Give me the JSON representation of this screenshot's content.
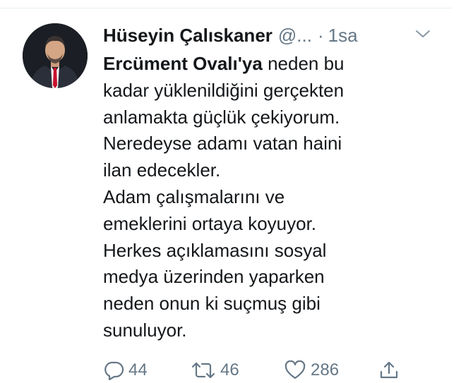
{
  "tweet": {
    "author_name": "Hüseyin Çalıskaner",
    "handle": "@...",
    "separator": "·",
    "time": "1sa",
    "text_lines": [
      {
        "bold": "Ercüment Ovalı'ya",
        "rest": " neden bu"
      },
      {
        "text": "kadar yüklenildiğini gerçekten"
      },
      {
        "text": "anlamakta güçlük çekiyorum."
      },
      {
        "text": "Neredeyse adamı vatan haini"
      },
      {
        "text": "ilan edecekler."
      },
      {
        "text": "Adam çalışmalarını ve"
      },
      {
        "text": "emeklerini ortaya koyuyor."
      },
      {
        "text": "Herkes açıklamasını sosyal"
      },
      {
        "text": "medya üzerinden yaparken"
      },
      {
        "text": "neden onun ki suçmuş gibi"
      },
      {
        "text": "sunuluyor."
      }
    ]
  },
  "actions": {
    "reply_count": "44",
    "retweet_count": "46",
    "like_count": "286"
  },
  "icons": {
    "reply": "reply-icon",
    "retweet": "retweet-icon",
    "like": "heart-icon",
    "share": "share-icon",
    "menu": "chevron-down-icon"
  },
  "colors": {
    "text": "#14171a",
    "secondary": "#657786",
    "divider": "#e6ecf0"
  }
}
